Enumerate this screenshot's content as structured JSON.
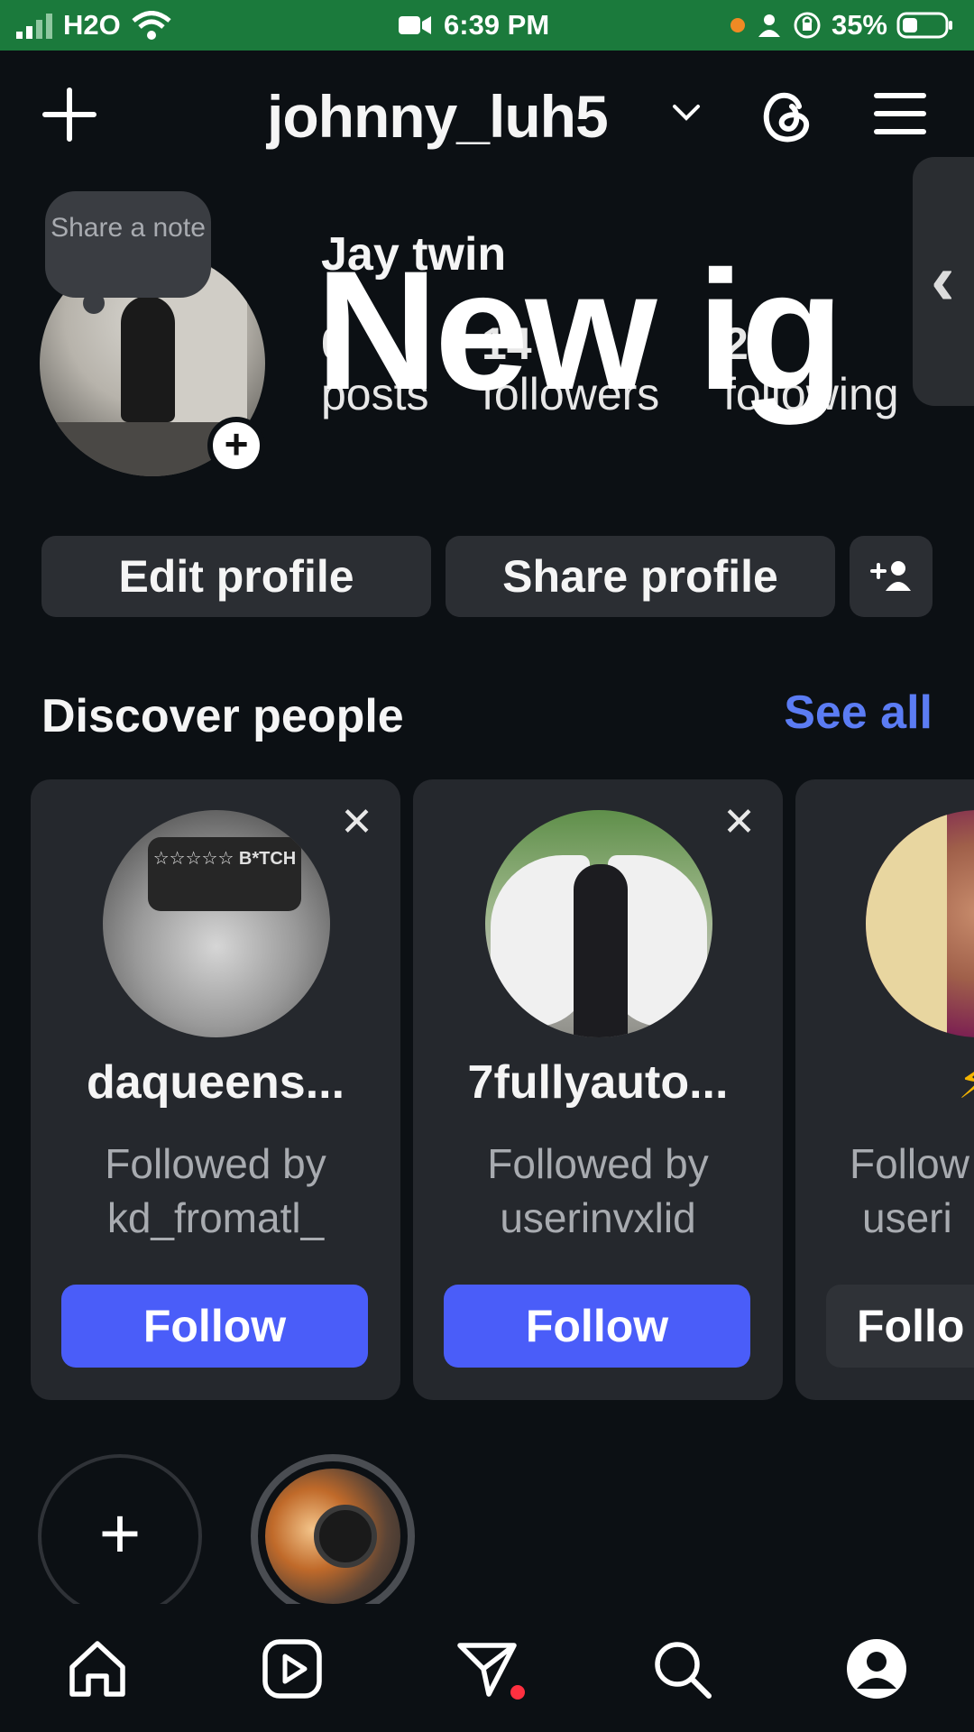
{
  "status_bar": {
    "carrier": "H2O",
    "time": "6:39 PM",
    "battery": "35%"
  },
  "header": {
    "username": "johnny_luh5"
  },
  "profile": {
    "note_text": "Share a note",
    "display_name": "Jay twin",
    "bio": "New ig",
    "stats": {
      "posts_count": "0",
      "posts_label": "posts",
      "followers_count": "14",
      "followers_label": "followers",
      "following_count": "20",
      "following_label": "following"
    }
  },
  "actions": {
    "edit_profile": "Edit profile",
    "share_profile": "Share profile"
  },
  "discover": {
    "title": "Discover people",
    "see_all": "See all",
    "cards": [
      {
        "username": "daqueens...",
        "followed_line1": "Followed by",
        "followed_line2": "kd_fromatl_",
        "button": "Follow",
        "photo_text": "☆☆☆☆☆ B*TCH"
      },
      {
        "username": "7fullyauto...",
        "followed_line1": "Followed by",
        "followed_line2": "userinvxlid",
        "button": "Follow"
      },
      {
        "username": "⚡",
        "followed_line1": "Follow",
        "followed_line2": "useri",
        "button": "Follo"
      }
    ]
  },
  "colors": {
    "background": "#0c1014",
    "status_bar": "#1b7a3c",
    "accent_blue": "#4a5df9",
    "link_blue": "#5b7cf4",
    "notification_red": "#ff3040"
  },
  "icons": {
    "header": [
      "plus-icon",
      "chevron-down-icon",
      "threads-icon",
      "menu-icon"
    ],
    "nav": [
      "home-icon",
      "reels-icon",
      "direct-message-icon",
      "search-icon",
      "profile-icon"
    ]
  }
}
